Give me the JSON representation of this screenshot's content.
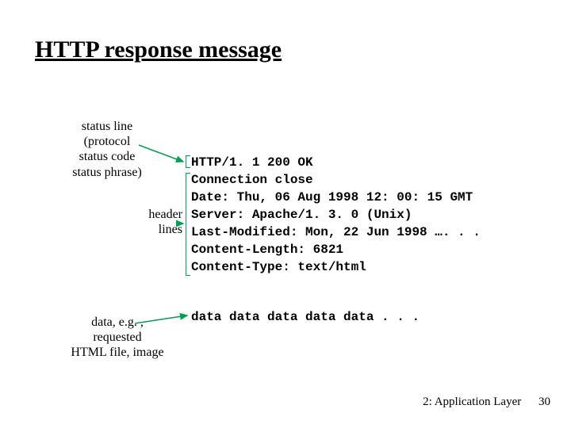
{
  "title": "HTTP response message",
  "labels": {
    "status_line": "status line\n(protocol\nstatus code\nstatus phrase)",
    "header_lines": "header\nlines",
    "data": "data, e.g. ,\nrequested\nHTML file, image"
  },
  "response": {
    "status_line": "HTTP/1. 1 200 OK",
    "headers": [
      "Connection close",
      "Date: Thu, 06 Aug 1998 12: 00: 15 GMT",
      "Server: Apache/1. 3. 0 (Unix)",
      "Last-Modified: Mon, 22 Jun 1998 …. . .",
      "Content-Length: 6821",
      "Content-Type: text/html"
    ],
    "body": "data data data data data . . ."
  },
  "footer": {
    "chapter": "2: Application Layer",
    "page": "30"
  },
  "colors": {
    "arrow": "#00a050"
  }
}
